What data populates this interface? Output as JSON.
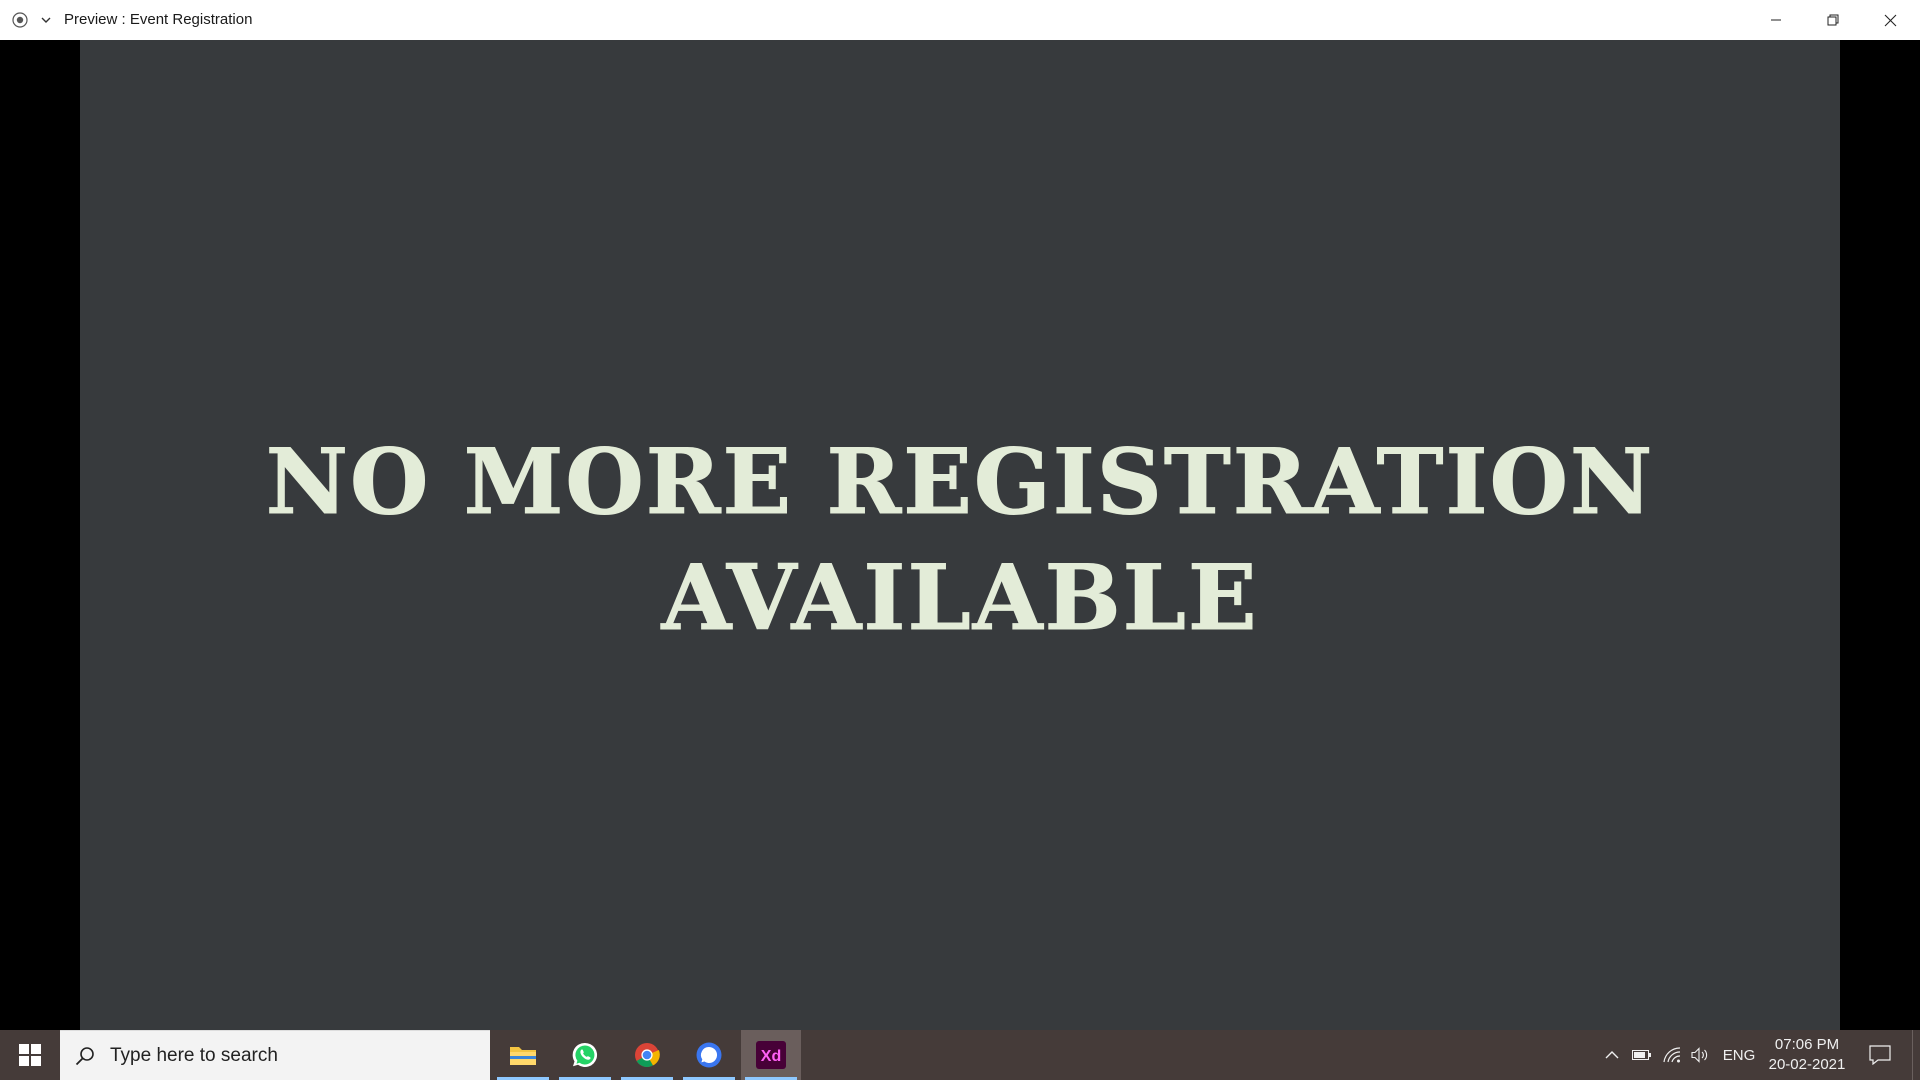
{
  "window": {
    "title": "Preview : Event Registration",
    "icons": {
      "record": "record-icon",
      "dropdown": "chevron-down-icon",
      "minimize": "minimize-icon",
      "maximize": "restore-icon",
      "close": "close-icon"
    }
  },
  "preview": {
    "background_color": "#373a3d",
    "text_color": "#e3ecd8",
    "message_line1": "NO MORE REGISTRATION",
    "message_line2": "AVAILABLE"
  },
  "taskbar": {
    "search_placeholder": "Type here to search",
    "apps": [
      {
        "name": "file-explorer-icon",
        "active": false
      },
      {
        "name": "whatsapp-icon",
        "active": false
      },
      {
        "name": "chrome-icon",
        "active": false
      },
      {
        "name": "signal-icon",
        "active": false
      },
      {
        "name": "adobe-xd-icon",
        "label": "Xd",
        "active": true
      }
    ],
    "tray": {
      "language": "ENG",
      "time": "07:06 PM",
      "date": "20-02-2021"
    }
  }
}
